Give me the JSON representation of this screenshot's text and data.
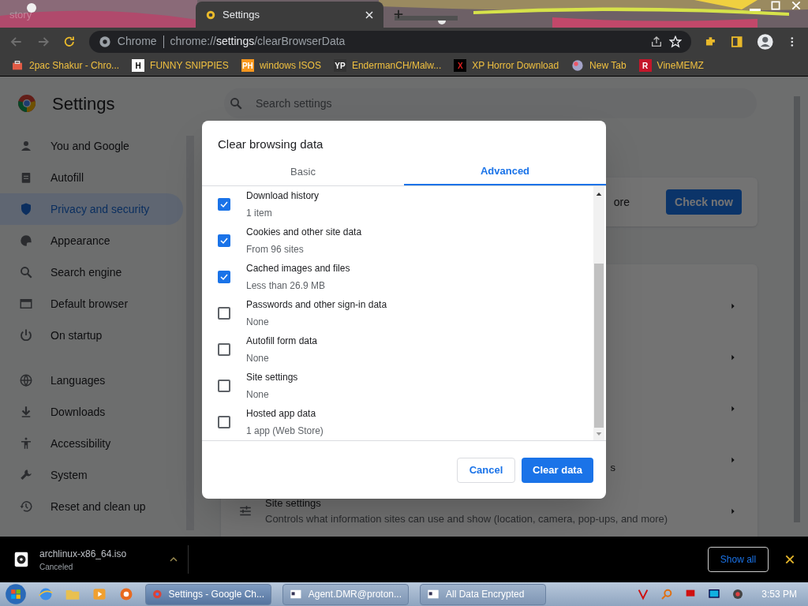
{
  "tabs": [
    {
      "title": "story",
      "selected": false
    },
    {
      "title": "Settings",
      "selected": true
    }
  ],
  "omnibox": {
    "chip": "Chrome",
    "url": "chrome://**settings**/clearBrowserData"
  },
  "bookmarks": [
    {
      "label": "2pac Shakur - Chro..."
    },
    {
      "label": "FUNNY SNIPPIES",
      "badge": "H",
      "color": "#ffffff"
    },
    {
      "label": "windows ISOS",
      "badge": "PH",
      "color": "#f7971d"
    },
    {
      "label": "EndermanCH/Malw...",
      "badge": "YP",
      "color": "#333333"
    },
    {
      "label": "XP Horror Download",
      "badge": "X",
      "color": "#000000"
    },
    {
      "label": "New Tab"
    },
    {
      "label": "VineMEMZ",
      "badge": "R",
      "color": "#c4162a"
    }
  ],
  "settings": {
    "title": "Settings",
    "search_placeholder": "Search settings",
    "sidebar": {
      "items": [
        {
          "label": "You and Google",
          "selected": false
        },
        {
          "label": "Autofill",
          "selected": false
        },
        {
          "label": "Privacy and security",
          "selected": true
        },
        {
          "label": "Appearance",
          "selected": false
        },
        {
          "label": "Search engine",
          "selected": false
        },
        {
          "label": "Default browser",
          "selected": false
        },
        {
          "label": "On startup",
          "selected": false
        }
      ],
      "advanced_items": [
        {
          "label": "Languages",
          "selected": false
        },
        {
          "label": "Downloads",
          "selected": false
        },
        {
          "label": "Accessibility",
          "selected": false
        },
        {
          "label": "System",
          "selected": false
        },
        {
          "label": "Reset and clean up",
          "selected": false
        }
      ]
    },
    "safety_card": {
      "text": "ore",
      "button": "Check now"
    },
    "rows": [
      {
        "title": ""
      },
      {
        "title": ""
      },
      {
        "title": ""
      },
      {
        "title": "s"
      },
      {
        "title": "Site settings",
        "description": "Controls what information sites can use and show (location, camera, pop-ups, and more)"
      }
    ]
  },
  "dialog": {
    "title": "Clear browsing data",
    "tabs": [
      {
        "label": "Basic",
        "selected": false
      },
      {
        "label": "Advanced",
        "selected": true
      }
    ],
    "items": [
      {
        "label": "Download history",
        "detail": "1 item",
        "checked": true
      },
      {
        "label": "Cookies and other site data",
        "detail": "From 96 sites",
        "checked": true
      },
      {
        "label": "Cached images and files",
        "detail": "Less than 26.9 MB",
        "checked": true
      },
      {
        "label": "Passwords and other sign-in data",
        "detail": "None",
        "checked": false
      },
      {
        "label": "Autofill form data",
        "detail": "None",
        "checked": false
      },
      {
        "label": "Site settings",
        "detail": "None",
        "checked": false
      },
      {
        "label": "Hosted app data",
        "detail": "1 app (Web Store)",
        "checked": false
      }
    ],
    "buttons": {
      "cancel": "Cancel",
      "confirm": "Clear data"
    }
  },
  "download_bar": {
    "file": "archlinux-x86_64.iso",
    "status": "Canceled",
    "show_all": "Show all"
  },
  "taskbar": {
    "windows": [
      {
        "label": "Settings - Google Ch...",
        "selected": true
      },
      {
        "label": "Agent.DMR@proton...",
        "selected": false
      },
      {
        "label": "All Data Encrypted",
        "selected": false
      }
    ],
    "clock": "3:53 PM"
  }
}
